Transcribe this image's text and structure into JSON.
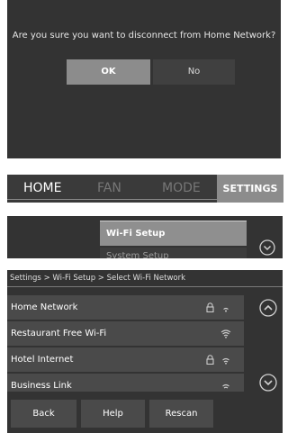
{
  "dialog": {
    "message": "Are you sure you want to disconnect from Home Network?",
    "ok_label": "OK",
    "no_label": "No"
  },
  "tabs": [
    {
      "label": "HOME"
    },
    {
      "label": "FAN"
    },
    {
      "label": "MODE"
    },
    {
      "label": "SETTINGS"
    }
  ],
  "settings_menu": {
    "items": [
      {
        "label": "Wi-Fi Setup"
      },
      {
        "label": "System Setup"
      }
    ],
    "icons": [
      "chevron-down-icon"
    ]
  },
  "wifi": {
    "breadcrumb": "Settings > Wi-Fi Setup > Select Wi-Fi Network",
    "networks": [
      {
        "name": "Home Network",
        "secured": true,
        "signal": "wifi-icon"
      },
      {
        "name": "Restaurant Free Wi-Fi",
        "secured": false,
        "signal": "wifi-icon"
      },
      {
        "name": "Hotel Internet",
        "secured": true,
        "signal": "wifi-icon"
      },
      {
        "name": "Business Link",
        "secured": false,
        "signal": "wifi-icon"
      }
    ],
    "buttons": {
      "back": "Back",
      "help": "Help",
      "rescan": "Rescan"
    },
    "icons": [
      "chevron-up-icon",
      "chevron-down-icon",
      "lock-icon"
    ]
  },
  "colors": {
    "panel_bg": "#333333",
    "selected": "#8c8c8c",
    "text": "#ffffff"
  }
}
